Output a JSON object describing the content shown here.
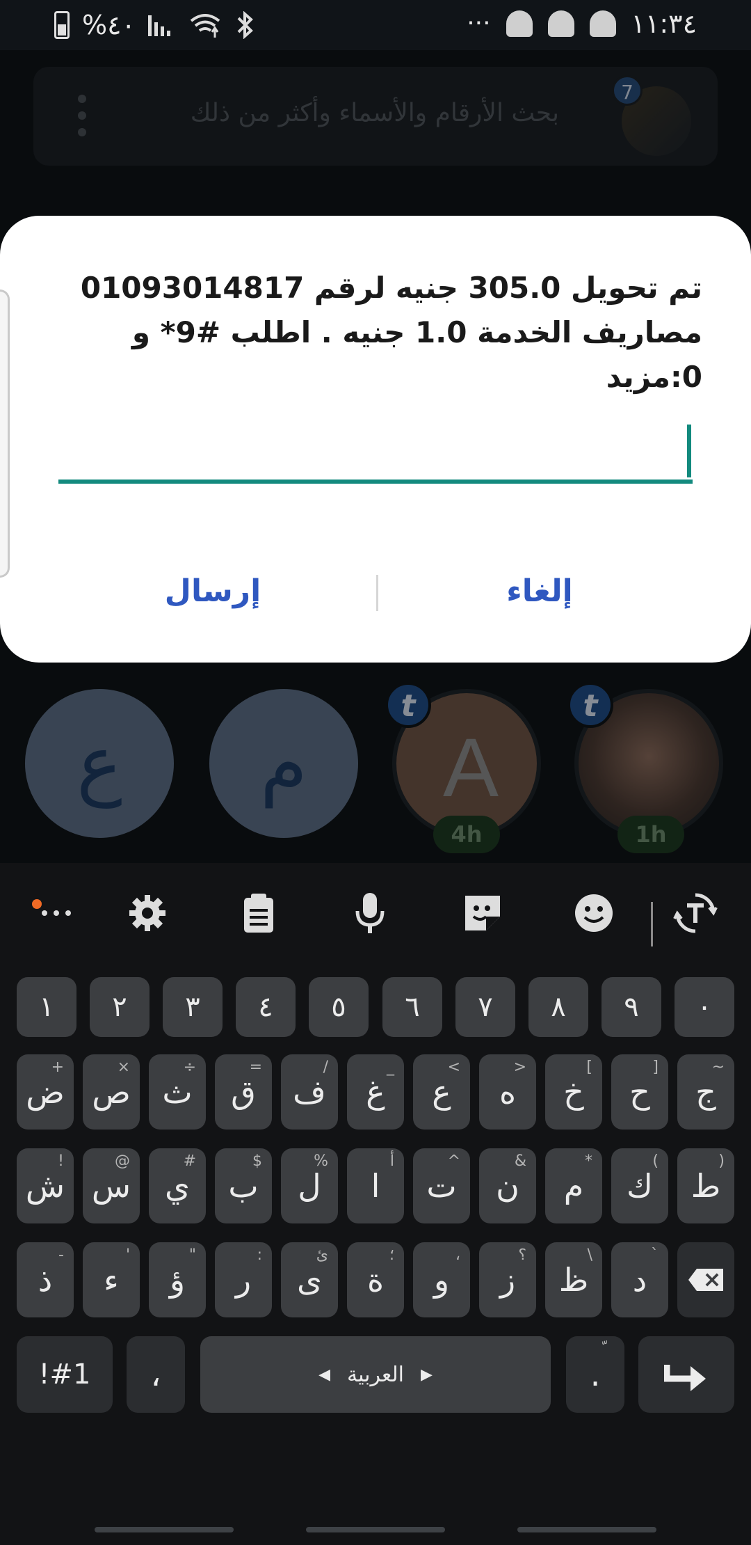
{
  "status_bar": {
    "battery_percent": "%٤٠",
    "clock": "١١:٣٤",
    "more_dots": "···"
  },
  "search": {
    "placeholder": "بحث الأرقام والأسماء وأكثر من ذلك",
    "badge_count": "7"
  },
  "dialog": {
    "message_lines": [
      "تم تحويل 305.0 جنيه لرقم 01093014817",
      "مصاريف الخدمة 1.0 جنيه . اطلب #9* و",
      "0:مزيد"
    ],
    "input_value": "",
    "send_label": "إرسال",
    "cancel_label": "إلغاء"
  },
  "contacts": [
    {
      "letter": "ع",
      "color": "#5c6f86"
    },
    {
      "letter": "م",
      "color": "#5c6f86"
    },
    {
      "letter": "A",
      "badge": "t",
      "time": "4h"
    },
    {
      "badge": "t",
      "time": "1h"
    }
  ],
  "keyboard": {
    "toolbar": [
      "more-icon",
      "settings-icon",
      "clipboard-icon",
      "mic-icon",
      "sticker-icon",
      "emoji-icon",
      "translate-icon"
    ],
    "digits": [
      "١",
      "٢",
      "٣",
      "٤",
      "٥",
      "٦",
      "٧",
      "٨",
      "٩",
      "٠"
    ],
    "row1": [
      {
        "k": "ض",
        "h": "+"
      },
      {
        "k": "ص",
        "h": "×"
      },
      {
        "k": "ث",
        "h": "÷"
      },
      {
        "k": "ق",
        "h": "="
      },
      {
        "k": "ف",
        "h": "/"
      },
      {
        "k": "غ",
        "h": "_"
      },
      {
        "k": "ع",
        "h": "<"
      },
      {
        "k": "ه",
        "h": ">"
      },
      {
        "k": "خ",
        "h": "["
      },
      {
        "k": "ح",
        "h": "]"
      },
      {
        "k": "ج",
        "h": "~"
      }
    ],
    "row2": [
      {
        "k": "ش",
        "h": "!"
      },
      {
        "k": "س",
        "h": "@"
      },
      {
        "k": "ي",
        "h": "#"
      },
      {
        "k": "ب",
        "h": "$"
      },
      {
        "k": "ل",
        "h": "%"
      },
      {
        "k": "ا",
        "h": "أ"
      },
      {
        "k": "ت",
        "h": "^"
      },
      {
        "k": "ن",
        "h": "&"
      },
      {
        "k": "م",
        "h": "*"
      },
      {
        "k": "ك",
        "h": "("
      },
      {
        "k": "ط",
        "h": ")"
      }
    ],
    "row3": [
      {
        "k": "ذ",
        "h": "-"
      },
      {
        "k": "ء",
        "h": "'"
      },
      {
        "k": "ؤ",
        "h": "\""
      },
      {
        "k": "ر",
        "h": ":"
      },
      {
        "k": "ى",
        "h": "ئ"
      },
      {
        "k": "ة",
        "h": "؛"
      },
      {
        "k": "و",
        "h": "،"
      },
      {
        "k": "ز",
        "h": "؟"
      },
      {
        "k": "ظ",
        "h": "\\"
      },
      {
        "k": "د",
        "h": "`"
      }
    ],
    "symbols_label": "!#1",
    "comma": "،",
    "space_label": "العربية",
    "period": ".",
    "period_hint": "ّ"
  }
}
